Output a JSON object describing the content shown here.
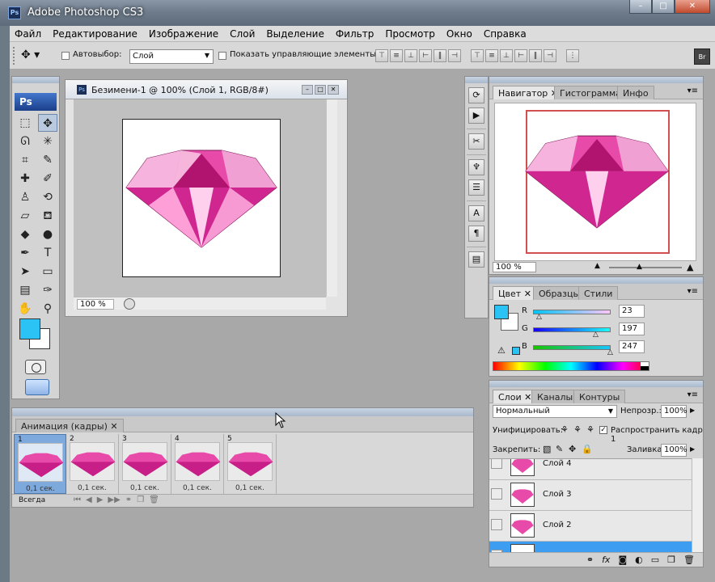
{
  "window": {
    "app_icon": "Ps",
    "title": "Adobe Photoshop CS3",
    "btn_min": "–",
    "btn_max": "□",
    "btn_close": "✕"
  },
  "menu": [
    "Файл",
    "Редактирование",
    "Изображение",
    "Слой",
    "Выделение",
    "Фильтр",
    "Просмотр",
    "Окно",
    "Справка"
  ],
  "options": {
    "auto_select_label": "Автовыбор:",
    "auto_select_value": "Слой",
    "show_controls_label": "Показать управляющие элементы"
  },
  "toolbox": {
    "logo": "Ps",
    "fg_color": "#2bc2f5",
    "bg_color": "#ffffff"
  },
  "document": {
    "icon": "Ps",
    "title": "Безимени-1 @ 100% (Слой 1, RGB/8#)",
    "zoom": "100 %"
  },
  "animation": {
    "tab": "Анимация (кадры)",
    "tab_close": "✕",
    "frames": [
      {
        "num": "1",
        "delay": "0,1 сек."
      },
      {
        "num": "2",
        "delay": "0,1 сек."
      },
      {
        "num": "3",
        "delay": "0,1 сек."
      },
      {
        "num": "4",
        "delay": "0,1 сек."
      },
      {
        "num": "5",
        "delay": "0,1 сек."
      }
    ],
    "loop": "Всегда"
  },
  "navigator": {
    "tabs": [
      "Навигатор",
      "Гистограмма",
      "Инфо"
    ],
    "zoom": "100 %"
  },
  "color": {
    "tabs": [
      "Цвет",
      "Образцы",
      "Стили"
    ],
    "r_label": "R",
    "g_label": "G",
    "b_label": "B",
    "r": "23",
    "g": "197",
    "b": "247"
  },
  "layers": {
    "tabs": [
      "Слои",
      "Каналы",
      "Контуры"
    ],
    "blend_mode": "Нормальный",
    "opacity_label": "Непрозр.:",
    "opacity": "100%",
    "unify_label": "Унифицировать:",
    "propagate_label": "Распространить кадр 1",
    "lock_label": "Закрепить:",
    "fill_label": "Заливка:",
    "fill": "100%",
    "items": [
      "Слой 4",
      "Слой 3",
      "Слой 2"
    ]
  }
}
